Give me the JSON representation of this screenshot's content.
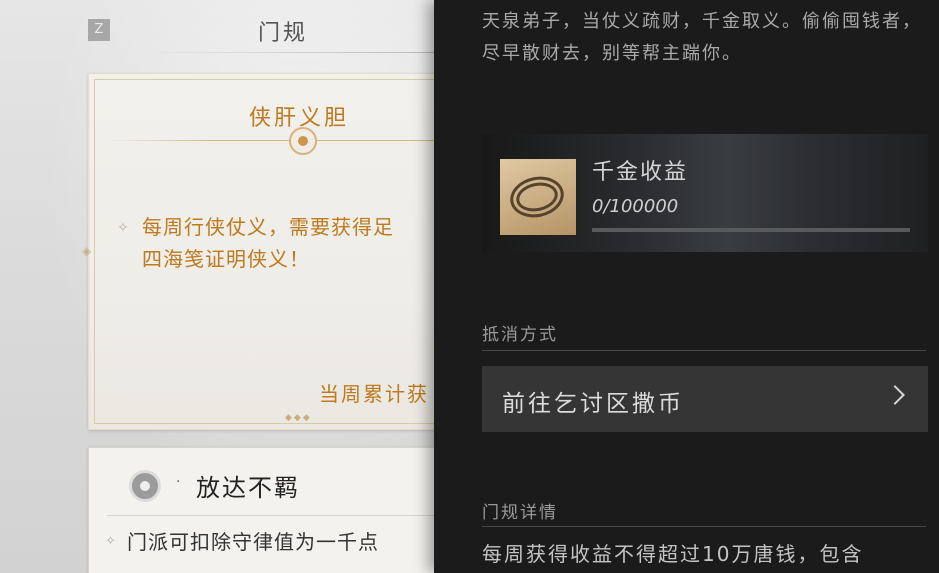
{
  "left_panel": {
    "key_hint": "Z",
    "title": "门规",
    "card1": {
      "title": "侠肝义胆",
      "text_line1": "每周行侠仗义，需要获得足",
      "text_line2": "四海笺证明侠义！",
      "footer": "当周累计获"
    },
    "card2": {
      "title": "放达不羁",
      "text": "门派可扣除守律值为一千点"
    }
  },
  "right_panel": {
    "description": "天泉弟子，当仗义疏财，千金取义。偷偷囤钱者，尽早散财去，别等帮主踹你。",
    "reward": {
      "icon": "silver-coin-string-icon",
      "label": "千金收益",
      "value": "0/100000",
      "progress": 0
    },
    "offset_section": {
      "title": "抵消方式",
      "action_label": "前往乞讨区撒币"
    },
    "details_section": {
      "title": "门规详情",
      "text": "每周获得收益不得超过10万唐钱，包含"
    }
  }
}
